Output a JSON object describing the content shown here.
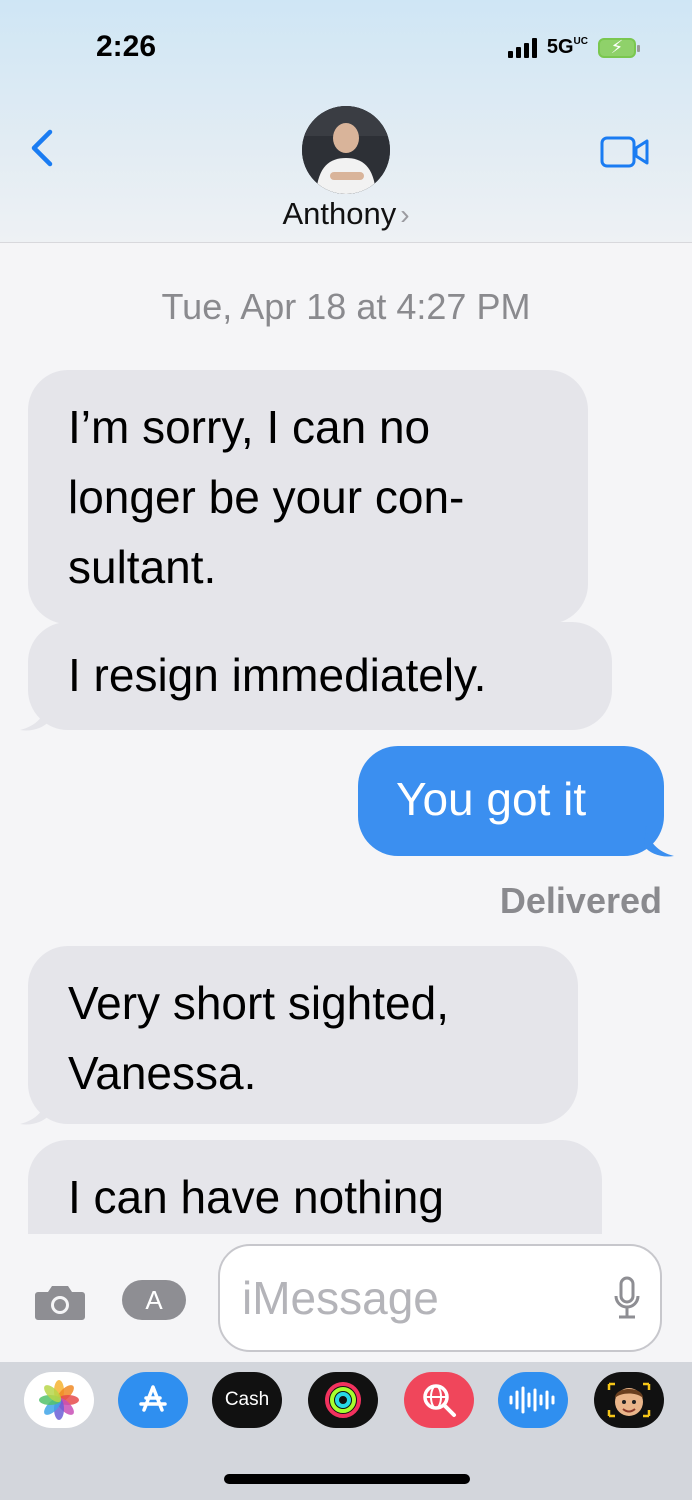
{
  "status_bar": {
    "time": "2:26",
    "network": "5G",
    "network_sub": "UC"
  },
  "header": {
    "contact_name": "Anthony",
    "chevron": "›"
  },
  "conversation": {
    "timestamp_day": "Tue, Apr 18",
    "timestamp_at": "at",
    "timestamp_time": "4:27 PM",
    "messages": [
      {
        "dir": "in",
        "lines": [
          "I’m sorry, I can no",
          "longer be your con-",
          "sultant."
        ]
      },
      {
        "dir": "in",
        "lines": [
          "I resign immediately."
        ]
      },
      {
        "dir": "out",
        "lines": [
          "You got it"
        ]
      },
      {
        "dir": "in",
        "lines": [
          "Very short sighted,",
          "Vanessa."
        ]
      },
      {
        "dir": "in",
        "lines": [
          "I can have nothing"
        ]
      }
    ],
    "delivered": "Delivered"
  },
  "input": {
    "placeholder": "iMessage"
  },
  "app_tray": {
    "cash_label": "Cash",
    "apple_glyph": "",
    "items": [
      "photos-icon",
      "app-store-icon",
      "apple-cash-icon",
      "activity-icon",
      "web-search-icon",
      "audio-message-icon",
      "memoji-icon"
    ]
  },
  "colors": {
    "bubble_out": "#3b8ff0",
    "bubble_in": "#e5e5ea",
    "accent": "#1a7cf2"
  }
}
